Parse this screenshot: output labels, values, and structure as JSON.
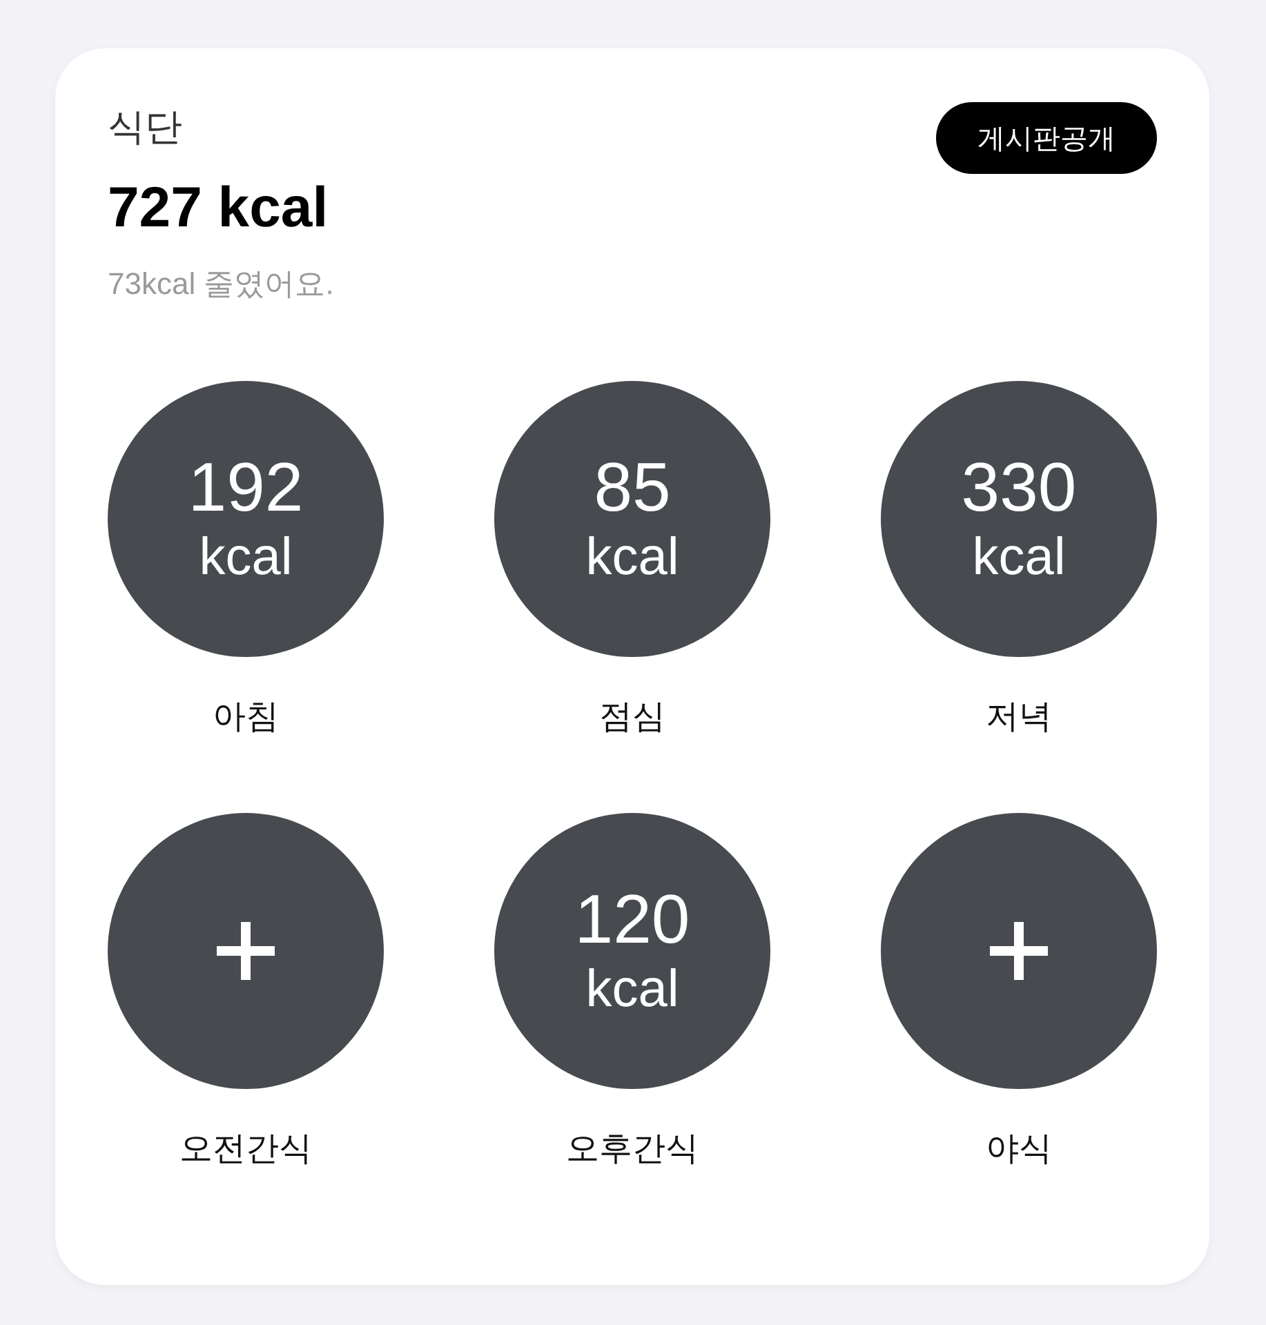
{
  "card": {
    "heading": "식단",
    "total": "727 kcal",
    "note": "73kcal 줄였어요.",
    "share_button": "게시판공개"
  },
  "meals": [
    {
      "kind": "logged",
      "value": "192",
      "unit": "kcal",
      "label": "아침"
    },
    {
      "kind": "logged",
      "value": "85",
      "unit": "kcal",
      "label": "점심"
    },
    {
      "kind": "logged",
      "value": "330",
      "unit": "kcal",
      "label": "저녁"
    },
    {
      "kind": "empty",
      "label": "오전간식"
    },
    {
      "kind": "logged",
      "value": "120",
      "unit": "kcal",
      "label": "오후간식"
    },
    {
      "kind": "empty",
      "label": "야식"
    }
  ]
}
